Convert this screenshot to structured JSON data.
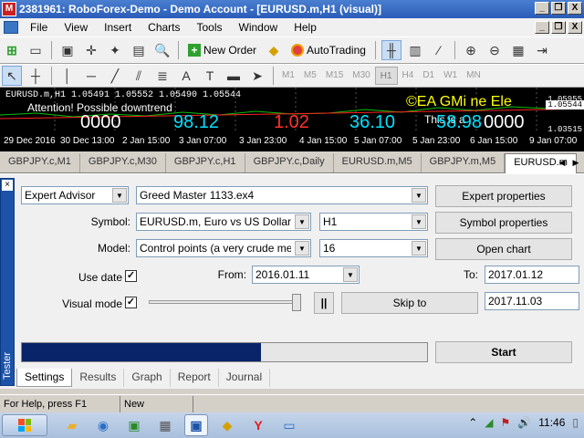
{
  "window": {
    "title": "2381961: RoboForex-Demo - Demo Account - [EURUSD.m,H1 (visual)]",
    "app_icon": "metatrader-icon",
    "controls": [
      "_",
      "❐",
      "X"
    ]
  },
  "menu": {
    "items": [
      "File",
      "View",
      "Insert",
      "Charts",
      "Tools",
      "Window",
      "Help"
    ],
    "mdi_controls": [
      "_",
      "❐",
      "X"
    ]
  },
  "toolbar1": {
    "new_order_label": "New Order",
    "autotrading_label": "AutoTrading"
  },
  "toolbar2": {
    "timeframes": [
      "M1",
      "M5",
      "M15",
      "M30",
      "H1",
      "H4",
      "D1",
      "W1",
      "MN"
    ],
    "selected_timeframe": "H1"
  },
  "chart": {
    "symbol_line": "EURUSD.m,H1  1.05491 1.05552 1.05490 1.05544",
    "attention_text": "Attention! Possible  downtrend",
    "ea_logo_text": "©EA GMi ne Ele",
    "caption_text": "This is a",
    "overlay_numbers": [
      {
        "text": "0000",
        "color": "#ffffff"
      },
      {
        "text": "98.12",
        "color": "#00e0ff"
      },
      {
        "text": "1.02",
        "color": "#ff3030"
      },
      {
        "text": "36.10",
        "color": "#00e0ff"
      },
      {
        "text": "58.98",
        "color": "#00e0ff"
      },
      {
        "text": "0000",
        "color": "#ffffff"
      }
    ],
    "prices": {
      "top": "1.05955",
      "current": "1.05544",
      "bottom": "1.03515"
    },
    "time_labels": [
      "29 Dec 2016",
      "30 Dec 13:00",
      "2 Jan 15:00",
      "3 Jan 07:00",
      "3 Jan 23:00",
      "4 Jan 15:00",
      "5 Jan 07:00",
      "5 Jan 23:00",
      "6 Jan 15:00",
      "9 Jan 07:00"
    ]
  },
  "chart_tabs": {
    "items": [
      "GBPJPY.c,M1",
      "GBPJPY.c,M30",
      "GBPJPY.c,H1",
      "GBPJPY.c,Daily",
      "EURUSD.m,M5",
      "GBPJPY.m,M5",
      "EURUSD.m"
    ],
    "active_index": 6
  },
  "tester": {
    "side_label": "Tester",
    "close_glyph": "×",
    "mode_value": "Expert Advisor",
    "expert_value": "Greed Master 1133.ex4",
    "expert_properties_label": "Expert properties",
    "symbol_label": "Symbol:",
    "symbol_value": "EURUSD.m, Euro vs US Dollar",
    "period_value": "H1",
    "symbol_properties_label": "Symbol properties",
    "model_label": "Model:",
    "model_value": "Control points (a very crude method",
    "spread_value": "16",
    "open_chart_label": "Open chart",
    "use_date_label": "Use date",
    "use_date_checked": "✓",
    "from_label": "From:",
    "from_value": "2016.01.11",
    "to_label": "To:",
    "to_value": "2017.01.12",
    "visual_mode_label": "Visual mode",
    "visual_mode_checked": "✓",
    "pause_label": "||",
    "skip_to_label": "Skip to",
    "skip_to_value": "2017.11.03",
    "visual_speed_fraction": 1.0,
    "progress_fraction": 0.59,
    "start_label": "Start",
    "tabs": [
      "Settings",
      "Results",
      "Graph",
      "Report",
      "Journal"
    ],
    "active_tab_index": 0
  },
  "statusbar": {
    "help_text": "For Help, press F1",
    "profile_text": "New"
  },
  "taskbar": {
    "clock": "11:46",
    "apps": [
      "explorer-icon",
      "media-player-icon",
      "network-monitor-icon",
      "calculator-icon",
      "metatrader-icon",
      "forex-icon",
      "yandex-browser-icon",
      "remote-desktop-icon"
    ],
    "active_app_index": 4
  },
  "colors": {
    "title_gradient_start": "#4a7fd0",
    "progress_fill": "#0a246a",
    "tester_side": "#1c52a8",
    "chart_bg": "#000000",
    "ea_text": "#ffff00"
  }
}
